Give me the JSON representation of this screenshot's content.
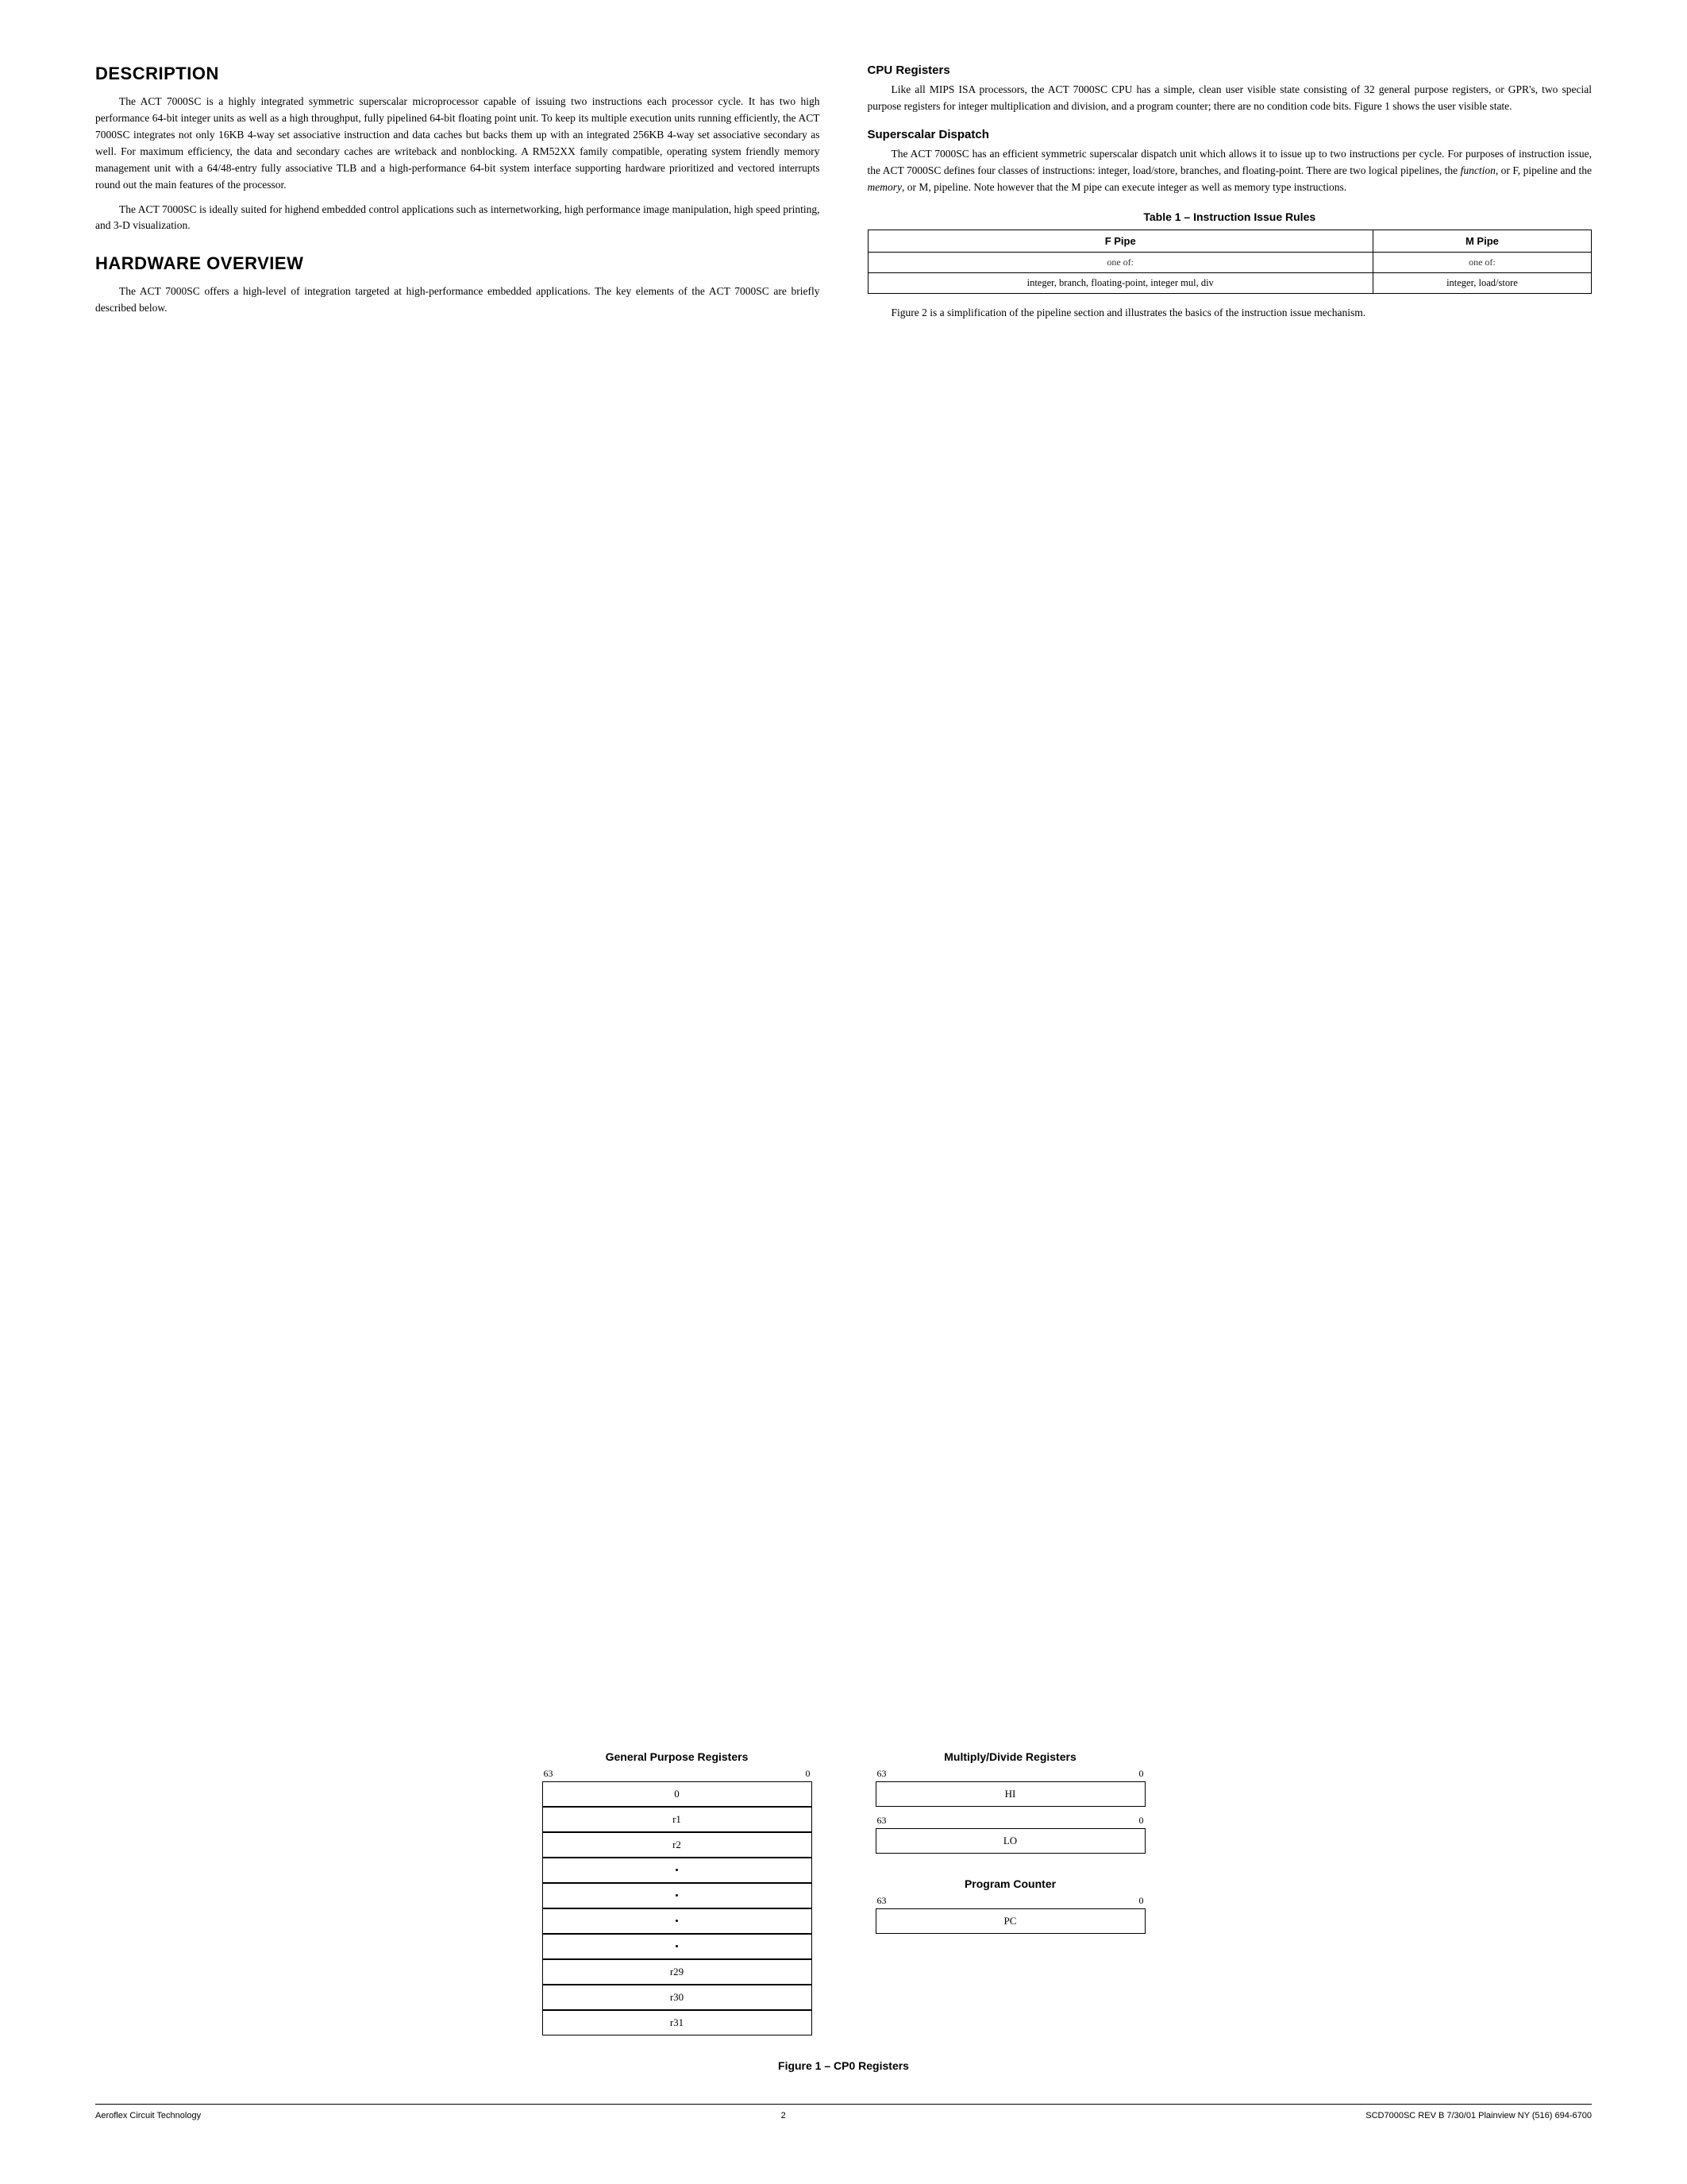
{
  "page": {
    "number": "2"
  },
  "footer": {
    "left": "Aeroflex Circuit Technology",
    "right": "SCD7000SC REV B  7/30/01  Plainview NY (516) 694-6700"
  },
  "description": {
    "title": "Description",
    "paragraphs": [
      "The ACT 7000SC is a highly integrated symmetric superscalar microprocessor capable of issuing two instructions each processor cycle. It has two high performance 64-bit integer units as well as a high throughput, fully pipelined 64-bit floating point unit. To keep its multiple execution units running efficiently, the ACT 7000SC integrates not only 16KB 4-way set associative instruction and data caches but backs them up with an integrated 256KB 4-way set associative secondary as well. For maximum efficiency, the data and secondary caches are writeback and nonblocking. A RM52XX family compatible, operating system friendly memory management unit with a 64/48-entry fully associative TLB and a high-performance 64-bit system interface supporting hardware prioritized and vectored interrupts round out the main features of the processor.",
      "The ACT 7000SC is ideally suited for highend embedded control applications such as internetworking, high performance image manipulation, high speed printing, and 3-D visualization."
    ]
  },
  "hardware_overview": {
    "title": "Hardware Overview",
    "paragraph": "The ACT 7000SC offers a high-level of integration targeted at high-performance embedded applications. The key elements of the ACT 7000SC are briefly described below."
  },
  "cpu_registers": {
    "title": "CPU Registers",
    "paragraph": "Like all MIPS ISA processors, the ACT 7000SC CPU has a simple, clean user visible state consisting of 32 general purpose registers, or GPR's, two special purpose registers for integer multiplication and division, and a program counter; there are no condition code bits. Figure 1 shows the user visible state."
  },
  "superscalar_dispatch": {
    "title": "Superscalar Dispatch",
    "paragraph": "The ACT 7000SC has an efficient symmetric superscalar dispatch unit which allows it to issue up to two instructions per cycle. For purposes of instruction issue, the ACT 7000SC defines four classes of instructions: integer, load/store, branches, and floating-point. There are two logical pipelines, the function, or F, pipeline and the memory, or M, pipeline. Note however that the M pipe can execute integer as well as memory type instructions."
  },
  "table": {
    "title": "Table 1 – Instruction Issue Rules",
    "col1_header": "F Pipe",
    "col2_header": "M Pipe",
    "row1_col1": "one of:",
    "row1_col2": "one of:",
    "row2_col1": "integer, branch, floating-point, integer mul, div",
    "row2_col2": "integer, load/store"
  },
  "table_note": "Figure 2 is a simplification of the pipeline section and illustrates the basics of the instruction issue mechanism.",
  "figure": {
    "caption": "Figure 1 – CP0 Registers",
    "gpr": {
      "title": "General Purpose Registers",
      "bit_high": "63",
      "bit_low": "0",
      "rows": [
        "0",
        "r1",
        "r2",
        "•",
        "•",
        "•",
        "•",
        "r29",
        "r30",
        "r31"
      ]
    },
    "mdr": {
      "title": "Multiply/Divide Registers",
      "hi_bit_high": "63",
      "hi_bit_low": "0",
      "hi_label": "HI",
      "lo_bit_high": "63",
      "lo_bit_low": "0",
      "lo_label": "LO"
    },
    "pc": {
      "title": "Program Counter",
      "bit_high": "63",
      "bit_low": "0",
      "label": "PC"
    }
  }
}
